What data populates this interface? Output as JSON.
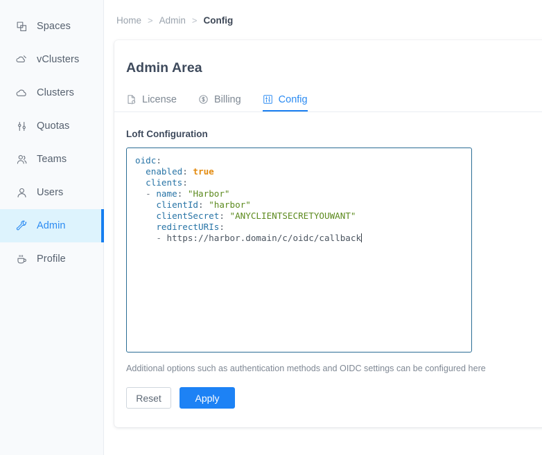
{
  "sidebar": {
    "items": [
      {
        "label": "Spaces",
        "icon": "spaces-icon",
        "active": false
      },
      {
        "label": "vClusters",
        "icon": "vclusters-icon",
        "active": false
      },
      {
        "label": "Clusters",
        "icon": "cloud-icon",
        "active": false
      },
      {
        "label": "Quotas",
        "icon": "sliders-icon",
        "active": false
      },
      {
        "label": "Teams",
        "icon": "users-group-icon",
        "active": false
      },
      {
        "label": "Users",
        "icon": "user-icon",
        "active": false
      },
      {
        "label": "Admin",
        "icon": "wrench-icon",
        "active": true
      },
      {
        "label": "Profile",
        "icon": "coffee-cup-icon",
        "active": false
      }
    ],
    "active_color": "#2b8bf2",
    "active_bg": "#ddf3fd",
    "active_bar": "#167ef0"
  },
  "breadcrumb": {
    "items": [
      {
        "label": "Home",
        "current": false
      },
      {
        "label": "Admin",
        "current": false
      },
      {
        "label": "Config",
        "current": true
      }
    ],
    "separator": ">"
  },
  "card": {
    "title": "Admin Area",
    "tabs": [
      {
        "label": "License",
        "icon": "license-document-icon",
        "active": false
      },
      {
        "label": "Billing",
        "icon": "dollar-circle-icon",
        "active": false
      },
      {
        "label": "Config",
        "icon": "sliders-square-icon",
        "active": true
      }
    ],
    "section_label": "Loft Configuration",
    "hint": "Additional options such as authentication methods and OIDC settings can be configured here",
    "buttons": {
      "reset": "Reset",
      "apply": "Apply"
    }
  },
  "editor": {
    "language": "yaml",
    "border_color": "#2a6c94",
    "cursor_visible": true,
    "value": "oidc:\n  enabled: true\n  clients:\n  - name: \"Harbor\"\n    clientId: \"harbor\"\n    clientSecret: \"ANYCLIENTSECRETYOUWANT\"\n    redirectURIs:\n    - https://harbor.domain/c/oidc/callback",
    "tokens": [
      [
        {
          "t": "oidc",
          "c": "k"
        },
        {
          "t": ":",
          "c": "p"
        }
      ],
      [
        {
          "t": "  ",
          "c": "p"
        },
        {
          "t": "enabled",
          "c": "k"
        },
        {
          "t": ": ",
          "c": "p"
        },
        {
          "t": "true",
          "c": "b"
        }
      ],
      [
        {
          "t": "  ",
          "c": "p"
        },
        {
          "t": "clients",
          "c": "k"
        },
        {
          "t": ":",
          "c": "p"
        }
      ],
      [
        {
          "t": "  - ",
          "c": "d"
        },
        {
          "t": "name",
          "c": "k"
        },
        {
          "t": ": ",
          "c": "p"
        },
        {
          "t": "\"Harbor\"",
          "c": "s"
        }
      ],
      [
        {
          "t": "    ",
          "c": "p"
        },
        {
          "t": "clientId",
          "c": "k"
        },
        {
          "t": ": ",
          "c": "p"
        },
        {
          "t": "\"harbor\"",
          "c": "s"
        }
      ],
      [
        {
          "t": "    ",
          "c": "p"
        },
        {
          "t": "clientSecret",
          "c": "k"
        },
        {
          "t": ": ",
          "c": "p"
        },
        {
          "t": "\"ANYCLIENTSECRETYOUWANT\"",
          "c": "s"
        }
      ],
      [
        {
          "t": "    ",
          "c": "p"
        },
        {
          "t": "redirectURIs",
          "c": "k"
        },
        {
          "t": ":",
          "c": "p"
        }
      ],
      [
        {
          "t": "    - ",
          "c": "d"
        },
        {
          "t": "https://harbor.domain/c/oidc/callback",
          "c": "p"
        },
        {
          "t": "|CARET|",
          "c": "caret"
        }
      ]
    ],
    "colors": {
      "key": "#2874a6",
      "boolean": "#e38b10",
      "string": "#5c8a1e",
      "plain": "#4b5560"
    }
  }
}
